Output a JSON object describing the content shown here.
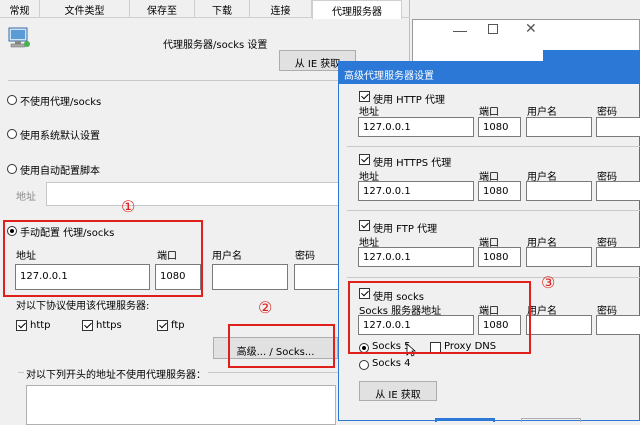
{
  "main": {
    "tabs": [
      "常规",
      "文件类型",
      "保存至",
      "下载",
      "连接",
      "代理服务器"
    ],
    "title": "代理服务器/socks 设置",
    "ie_button": "从 IE 获取",
    "radio_no_proxy": "不使用代理/socks",
    "radio_system": "使用系统默认设置",
    "radio_auto": "使用自动配置脚本",
    "addr_label": "地址",
    "radio_manual": "手动配置 代理/socks",
    "col_addr": "地址",
    "col_port": "端口",
    "col_user": "用户名",
    "col_pass": "密码",
    "addr_value": "127.0.0.1",
    "port_value": "1080",
    "protocols_label": "对以下协议使用该代理服务器:",
    "proto_http": "http",
    "proto_https": "https",
    "proto_ftp": "ftp",
    "advanced_button": "高级... / Socks...",
    "exclude_label": "对以下列开头的地址不使用代理服务器："
  },
  "annotations": {
    "a1": "①",
    "a2": "②",
    "a3": "③"
  },
  "adv": {
    "title": "高级代理服务器设置",
    "http_label": "使用 HTTP 代理",
    "https_label": "使用 HTTPS 代理",
    "ftp_label": "使用 FTP 代理",
    "socks_label": "使用 socks",
    "col_addr": "地址",
    "col_port": "端口",
    "col_user": "用户名",
    "col_pass": "密码",
    "socks_addr_label": "Socks 服务器地址",
    "addr_value": "127.0.0.1",
    "port_value": "1080",
    "socks5": "Socks 5",
    "socks4": "Socks 4",
    "proxy_dns": "Proxy DNS",
    "ie_button": "从 IE 获取"
  },
  "colors": {
    "red": "#e0201b",
    "title_blue": "#2b78d6",
    "window_bg": "#f0f0f0"
  }
}
